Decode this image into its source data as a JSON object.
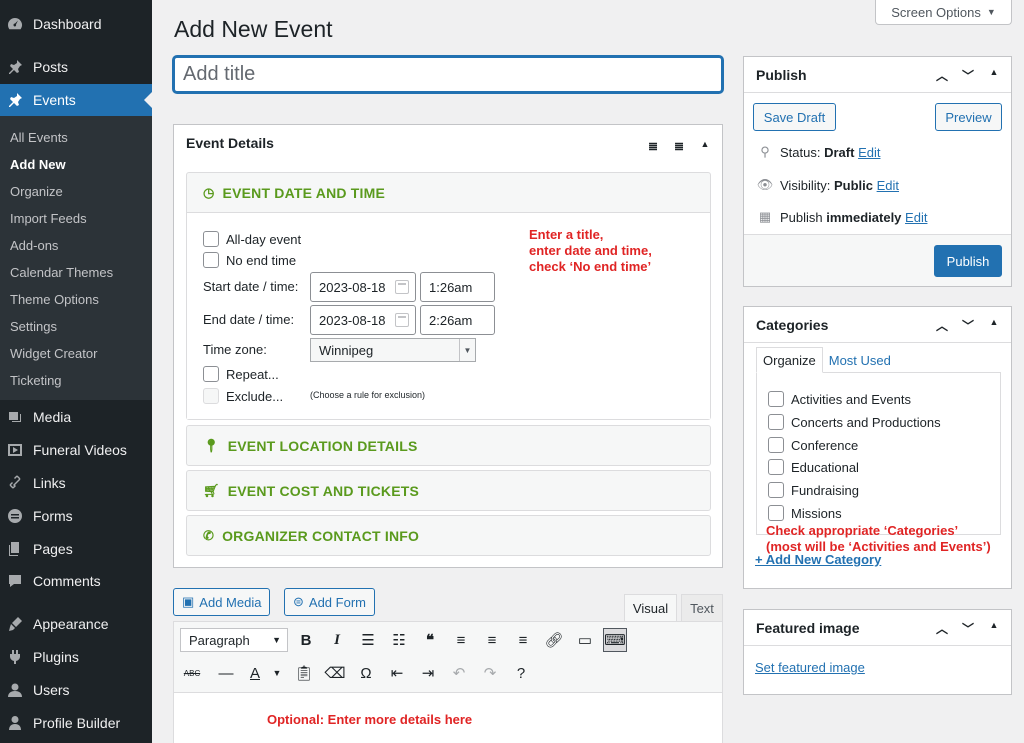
{
  "sidebar": {
    "top": [
      {
        "label": "Dashboard",
        "icon": "dashboard-icon"
      },
      {
        "label": "Posts",
        "icon": "pin-icon"
      },
      {
        "label": "Events",
        "icon": "pin-icon"
      }
    ],
    "events_submenu": [
      "All Events",
      "Add New",
      "Organize",
      "Import Feeds",
      "Add-ons",
      "Calendar Themes",
      "Theme Options",
      "Settings",
      "Widget Creator",
      "Ticketing"
    ],
    "bottom": [
      {
        "label": "Media",
        "icon": "media-icon"
      },
      {
        "label": "Funeral Videos",
        "icon": "video-icon"
      },
      {
        "label": "Links",
        "icon": "link-icon"
      },
      {
        "label": "Forms",
        "icon": "forms-icon"
      },
      {
        "label": "Pages",
        "icon": "pages-icon"
      },
      {
        "label": "Comments",
        "icon": "comments-icon"
      },
      {
        "label": "Appearance",
        "icon": "appearance-icon"
      },
      {
        "label": "Plugins",
        "icon": "plugins-icon"
      },
      {
        "label": "Users",
        "icon": "users-icon"
      },
      {
        "label": "Profile Builder",
        "icon": "profile-icon"
      }
    ]
  },
  "header": {
    "page_title": "Add New Event",
    "screen_options": "Screen Options",
    "title_placeholder": "Add title"
  },
  "event_details": {
    "heading": "Event Details",
    "date_section": "EVENT DATE AND TIME",
    "all_day": "All-day event",
    "no_end_time": "No end time",
    "start_label": "Start date / time:",
    "start_date": "2023-08-18",
    "start_time": "1:26am",
    "end_label": "End date / time:",
    "end_date": "2023-08-18",
    "end_time": "2:26am",
    "timezone_label": "Time zone:",
    "timezone": "Winnipeg",
    "repeat": "Repeat...",
    "exclude": "Exclude...",
    "exclude_hint": "(Choose a rule for exclusion)",
    "location_section": "EVENT LOCATION DETAILS",
    "cost_section": "EVENT COST AND TICKETS",
    "organizer_section": "ORGANIZER CONTACT INFO"
  },
  "annotations": {
    "title_note": [
      "Enter a title,",
      "enter date and time,",
      "check ‘No end time’"
    ],
    "categories_note": [
      "Check appropriate ‘Categories’",
      "(most will be ‘Activities and Events’)"
    ],
    "editor_note": "Optional: Enter more details here"
  },
  "publish": {
    "heading": "Publish",
    "save_draft": "Save Draft",
    "preview": "Preview",
    "status_label": "Status:",
    "status_value": "Draft",
    "visibility_label": "Visibility:",
    "visibility_value": "Public",
    "publish_label": "Publish",
    "publish_value": "immediately",
    "edit": "Edit",
    "publish_button": "Publish"
  },
  "categories": {
    "heading": "Categories",
    "tab_organize": "Organize",
    "tab_most_used": "Most Used",
    "items": [
      "Activities and Events",
      "Concerts and Productions",
      "Conference",
      "Educational",
      "Fundraising",
      "Missions"
    ],
    "add_new": "+ Add New Category"
  },
  "featured_image": {
    "heading": "Featured image",
    "set_link": "Set featured image"
  },
  "editor": {
    "add_media": "Add Media",
    "add_form": "Add Form",
    "tab_visual": "Visual",
    "tab_text": "Text",
    "format_select": "Paragraph"
  },
  "colors": {
    "accent": "#2271b1",
    "sidebar_bg": "#1d2327",
    "section_green": "#5a9a1d",
    "annotation_red": "#e02424"
  }
}
